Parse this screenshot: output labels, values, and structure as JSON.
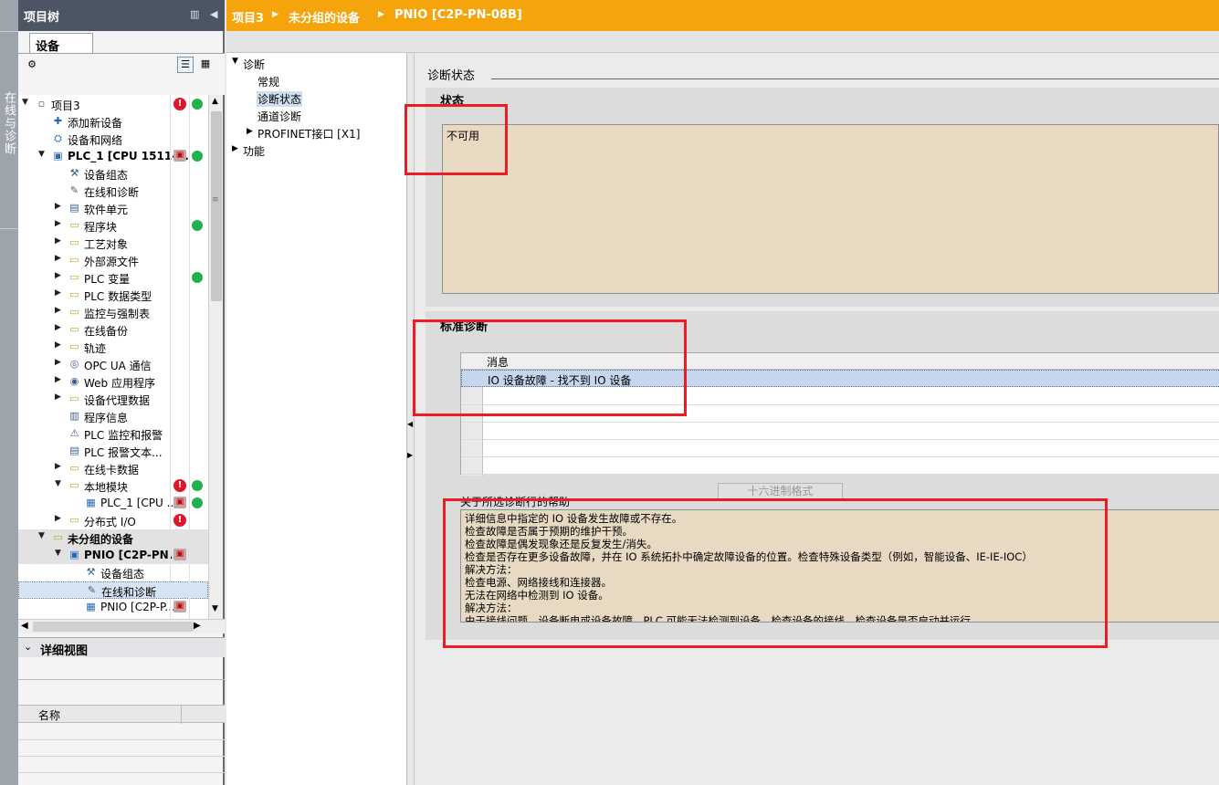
{
  "side_strip": {
    "label": "在线与诊断"
  },
  "project_tree": {
    "title": "项目树",
    "tab": "设备",
    "items": [
      {
        "label": "项目3",
        "indent": 0,
        "arrow": "down",
        "icon": "project-icon",
        "status1": "error",
        "status2": "ok"
      },
      {
        "label": "添加新设备",
        "indent": 1,
        "arrow": "",
        "icon": "add-device-icon",
        "status1": "",
        "status2": ""
      },
      {
        "label": "设备和网络",
        "indent": 1,
        "arrow": "",
        "icon": "network-icon",
        "status1": "",
        "status2": ""
      },
      {
        "label": "PLC_1 [CPU 1511-...",
        "indent": 1,
        "arrow": "down",
        "icon": "plc-icon",
        "status1": "device",
        "status2": "ok",
        "bold": true
      },
      {
        "label": "设备组态",
        "indent": 2,
        "arrow": "",
        "icon": "device-config-icon",
        "status1": "",
        "status2": ""
      },
      {
        "label": "在线和诊断",
        "indent": 2,
        "arrow": "",
        "icon": "online-diag-icon",
        "status1": "",
        "status2": ""
      },
      {
        "label": "软件单元",
        "indent": 2,
        "arrow": "right",
        "icon": "software-unit-icon",
        "status1": "",
        "status2": ""
      },
      {
        "label": "程序块",
        "indent": 2,
        "arrow": "right",
        "icon": "folder-icon",
        "status1": "",
        "status2": "ok"
      },
      {
        "label": "工艺对象",
        "indent": 2,
        "arrow": "right",
        "icon": "folder-icon",
        "status1": "",
        "status2": ""
      },
      {
        "label": "外部源文件",
        "indent": 2,
        "arrow": "right",
        "icon": "folder-icon",
        "status1": "",
        "status2": ""
      },
      {
        "label": "PLC 变量",
        "indent": 2,
        "arrow": "right",
        "icon": "folder-icon",
        "status1": "",
        "status2": "ok"
      },
      {
        "label": "PLC 数据类型",
        "indent": 2,
        "arrow": "right",
        "icon": "folder-icon",
        "status1": "",
        "status2": ""
      },
      {
        "label": "监控与强制表",
        "indent": 2,
        "arrow": "right",
        "icon": "folder-icon",
        "status1": "",
        "status2": ""
      },
      {
        "label": "在线备份",
        "indent": 2,
        "arrow": "right",
        "icon": "folder-icon",
        "status1": "",
        "status2": ""
      },
      {
        "label": "轨迹",
        "indent": 2,
        "arrow": "right",
        "icon": "folder-icon",
        "status1": "",
        "status2": ""
      },
      {
        "label": "OPC UA 通信",
        "indent": 2,
        "arrow": "right",
        "icon": "opc-ua-icon",
        "status1": "",
        "status2": ""
      },
      {
        "label": "Web 应用程序",
        "indent": 2,
        "arrow": "right",
        "icon": "web-icon",
        "status1": "",
        "status2": ""
      },
      {
        "label": "设备代理数据",
        "indent": 2,
        "arrow": "right",
        "icon": "folder-icon",
        "status1": "",
        "status2": ""
      },
      {
        "label": "程序信息",
        "indent": 2,
        "arrow": "",
        "icon": "program-info-icon",
        "status1": "",
        "status2": ""
      },
      {
        "label": "PLC 监控和报警",
        "indent": 2,
        "arrow": "",
        "icon": "alarm-icon",
        "status1": "",
        "status2": ""
      },
      {
        "label": "PLC 报警文本...",
        "indent": 2,
        "arrow": "",
        "icon": "alarm-text-icon",
        "status1": "",
        "status2": ""
      },
      {
        "label": "在线卡数据",
        "indent": 2,
        "arrow": "right",
        "icon": "folder-icon",
        "status1": "",
        "status2": ""
      },
      {
        "label": "本地模块",
        "indent": 2,
        "arrow": "down",
        "icon": "folder-icon",
        "status1": "error",
        "status2": "ok"
      },
      {
        "label": "PLC_1 [CPU ...",
        "indent": 3,
        "arrow": "",
        "icon": "cpu-module-icon",
        "status1": "device",
        "status2": "ok"
      },
      {
        "label": "分布式 I/O",
        "indent": 2,
        "arrow": "right",
        "icon": "folder-icon",
        "status1": "error",
        "status2": ""
      },
      {
        "label": "未分组的设备",
        "indent": 1,
        "arrow": "down",
        "icon": "ungrouped-icon",
        "status1": "",
        "status2": "",
        "bold": true,
        "shade": true
      },
      {
        "label": "PNIO [C2P-PN...",
        "indent": 2,
        "arrow": "down",
        "icon": "pnio-icon",
        "status1": "fault",
        "status2": "",
        "bold": true,
        "shade": true
      },
      {
        "label": "设备组态",
        "indent": 3,
        "arrow": "",
        "icon": "device-config-icon",
        "status1": "",
        "status2": ""
      },
      {
        "label": "在线和诊断",
        "indent": 3,
        "arrow": "",
        "icon": "online-diag-icon",
        "status1": "",
        "status2": "",
        "selected": true
      },
      {
        "label": "PNIO [C2P-P...",
        "indent": 3,
        "arrow": "",
        "icon": "pnio-module-icon",
        "status1": "fault",
        "status2": ""
      }
    ]
  },
  "detail_view": {
    "title": "详细视图",
    "name_header": "名称"
  },
  "breadcrumb": [
    "项目3",
    "未分组的设备",
    "PNIO [C2P-PN-08B]"
  ],
  "nav": {
    "diagnostics": "诊断",
    "general": "常规",
    "diag_status": "诊断状态",
    "channel_diag": "通道诊断",
    "profinet": "PROFINET接口 [X1]",
    "functions": "功能"
  },
  "content": {
    "page_title": "诊断状态",
    "status_heading": "状态",
    "status_value": "不可用",
    "std_heading": "标准诊断",
    "table": {
      "header": "消息",
      "rows": [
        "IO 设备故障 - 找不到 IO 设备",
        "",
        "",
        "",
        "",
        ""
      ]
    },
    "hex_button": "十六进制格式",
    "help_label": "关于所选诊断行的帮助",
    "help_lines": [
      "详细信息中指定的 IO 设备发生故障或不存在。",
      "检查故障是否属于预期的维护干预。",
      "检查故障是偶发现象还是反复发生/消失。",
      "检查是否存在更多设备故障，并在 IO 系统拓扑中确定故障设备的位置。检查特殊设备类型（例如，智能设备、IE-IE-IOC）",
      "解决方法：",
      "检查电源、网络接线和连接器。",
      " 无法在网络中检测到 IO 设备。",
      "解决方法：",
      "由于接线问题、设备断电或设备故障，PLC 可能无法检测到设备。检查设备的接线，检查设备是否启动并运行。"
    ]
  },
  "colors": {
    "accent": "#f5a40b",
    "annotation": "#ec1c24",
    "status_bg": "#e8d9c3"
  }
}
